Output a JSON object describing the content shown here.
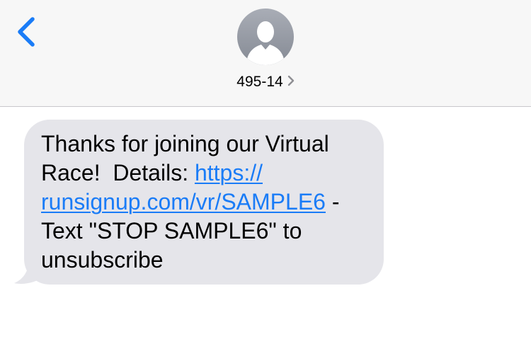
{
  "header": {
    "back_icon": "chevron-left-icon",
    "avatar_icon": "person-silhouette-icon",
    "contact_name": "495-14",
    "contact_chevron_icon": "chevron-right-icon"
  },
  "message": {
    "text_line1": "Thanks for joining our Virtual",
    "text_line2_prefix": "Race!  Details: ",
    "link_part1": "https://",
    "link_part2": "runsignup.com/vr/SAMPLE6",
    "text_after_link": " -",
    "text_line4": "Text \"STOP SAMPLE6\" to",
    "text_line5": "unsubscribe"
  },
  "colors": {
    "accent": "#1a7cf7",
    "bubble": "#e5e5ea",
    "header_bg": "#f7f7f7"
  }
}
